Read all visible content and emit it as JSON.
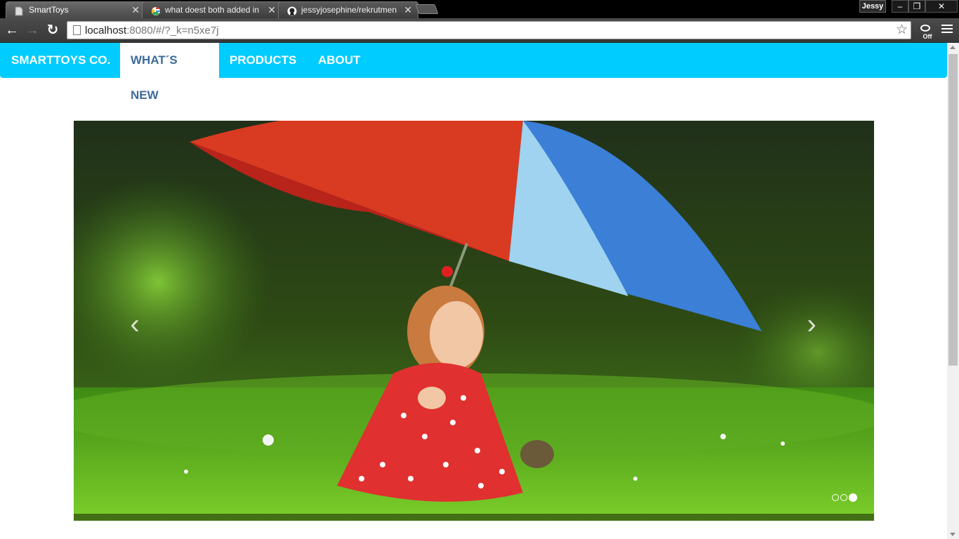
{
  "browser": {
    "tabs": [
      {
        "title": "SmartToys",
        "favicon": "page-icon",
        "active": true
      },
      {
        "title": "what doest both added in",
        "favicon": "google-icon",
        "active": false
      },
      {
        "title": "jessyjosephine/rekrutmen",
        "favicon": "github-icon",
        "active": false
      }
    ],
    "profile_name": "Jessy",
    "window_buttons": {
      "minimize": "–",
      "restore": "❐",
      "close": "✕"
    },
    "url_host": "localhost",
    "url_rest": ":8080/#/?_k=n5xe7j",
    "extension_label": "Off"
  },
  "site": {
    "brand": "SMARTTOYS CO.",
    "nav": [
      {
        "label": "WHAT´S NEW",
        "active": true
      },
      {
        "label": "PRODUCTS",
        "active": false
      },
      {
        "label": "ABOUT",
        "active": false
      }
    ],
    "colors": {
      "navbar": "#00ccff",
      "active_text": "#3c6b9c"
    }
  },
  "carousel": {
    "image": "girl-with-umbrella-photo",
    "prev_glyph": "‹",
    "next_glyph": "›",
    "slide_count": 3,
    "active_slide": 3
  }
}
